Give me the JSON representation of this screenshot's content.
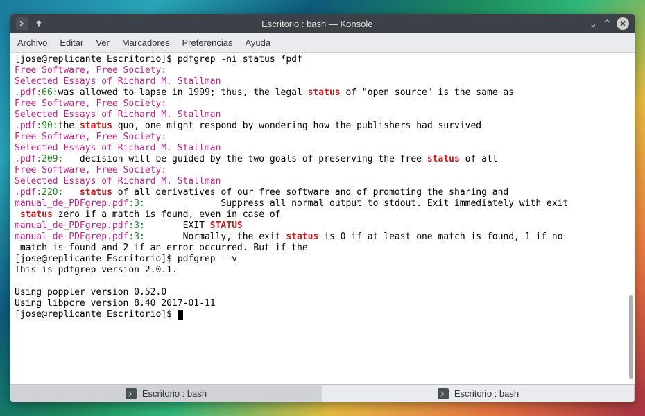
{
  "titlebar": {
    "title": "Escritorio : bash — Konsole"
  },
  "menu": {
    "archivo": "Archivo",
    "editar": "Editar",
    "ver": "Ver",
    "marcadores": "Marcadores",
    "preferencias": "Preferencias",
    "ayuda": "Ayuda"
  },
  "tabs": [
    {
      "label": "Escritorio : bash"
    },
    {
      "label": "Escritorio : bash"
    }
  ],
  "term": {
    "prompt1": "[jose@replicante Escritorio]$ ",
    "cmd1": "pdfgrep -ni status *pdf",
    "fsfs": "Free Software, Free Society:",
    "essays": "Selected Essays of Richard M. Stallman",
    "l1_file": ".pdf",
    "l1_ln": ":66:",
    "l1_a": "was allowed to lapse in 1999; thus, the legal ",
    "l1_m": "status",
    "l1_b": " of \"open source\" is the same as",
    "l2_ln": ":90:",
    "l2_a": "the ",
    "l2_m": "status",
    "l2_b": " quo, one might respond by wondering how the publishers had survived",
    "l3_ln": ":209:",
    "l3_a": "   decision will be guided by the two goals of preserving the free ",
    "l3_m": "status",
    "l3_b": " of all",
    "l4_ln": ":220:",
    "l4_a": "   ",
    "l4_m": "status",
    "l4_b": " of all derivatives of our free software and of promoting the sharing and",
    "m_file": "manual_de_PDFgrep.pdf",
    "m_ln": ":3:",
    "m1_a": "              Suppress all normal output to stdout. Exit immediately with exit",
    "m1b_a": " ",
    "m1b_m": "status",
    "m1b_b": " zero if a match is found, even in case of",
    "m2_a": "       EXIT ",
    "m2_m": "STATUS",
    "m3_a": "       Normally, the exit ",
    "m3_m": "status",
    "m3_b": " is 0 if at least one match is found, 1 if no",
    "m3c": " match is found and 2 if an error occurred. But if the",
    "cmd2": "pdfgrep --v",
    "ver1": "This is pdfgrep version 2.0.1.",
    "ver2": "Using poppler version 0.52.0",
    "ver3": "Using libpcre version 8.40 2017-01-11"
  }
}
